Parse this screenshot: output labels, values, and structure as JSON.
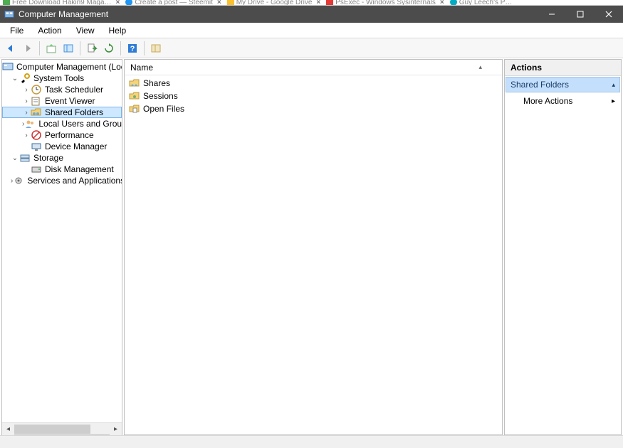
{
  "browser_tabs": [
    {
      "label": "Free Download Hakin9 Maga…",
      "color": "#4caf50"
    },
    {
      "label": "Create a post — Steemit",
      "color": "#2196f3"
    },
    {
      "label": "My Drive - Google Drive",
      "color": "#fbc02d"
    },
    {
      "label": "PsExec - Windows Sysinternals",
      "color": "#e53935"
    },
    {
      "label": "Guy Leech's P…",
      "color": "#00acc1"
    }
  ],
  "window": {
    "title": "Computer Management"
  },
  "menu": {
    "file": "File",
    "action": "Action",
    "view": "View",
    "help": "Help"
  },
  "tree": {
    "root": "Computer Management (Local",
    "system_tools": "System Tools",
    "task_scheduler": "Task Scheduler",
    "event_viewer": "Event Viewer",
    "shared_folders": "Shared Folders",
    "local_users": "Local Users and Groups",
    "performance": "Performance",
    "device_manager": "Device Manager",
    "storage": "Storage",
    "disk_management": "Disk Management",
    "services_apps": "Services and Applications"
  },
  "list": {
    "header_name": "Name",
    "items": {
      "shares": "Shares",
      "sessions": "Sessions",
      "open_files": "Open Files"
    }
  },
  "actions": {
    "header": "Actions",
    "section": "Shared Folders",
    "more_actions": "More Actions"
  }
}
